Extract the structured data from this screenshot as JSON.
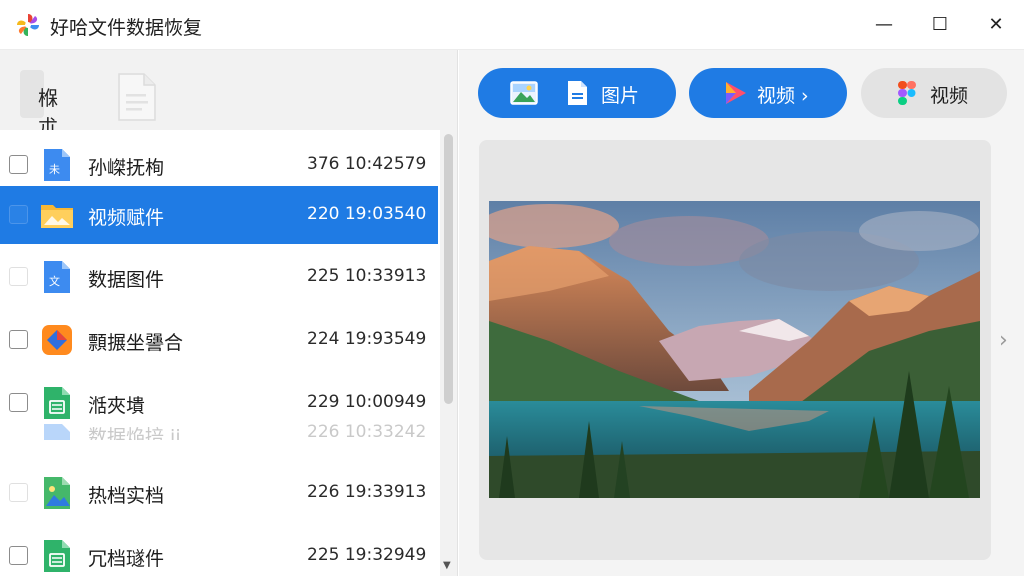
{
  "window": {
    "title": "好哈文件数据恢复",
    "minimize_glyph": "—",
    "maximize_glyph": "☐",
    "close_glyph": "✕"
  },
  "sidebar_header": {
    "tab_label": "椺 朮",
    "doc_icon": "document-icon"
  },
  "files": [
    {
      "name": "孙嵥抚栒",
      "meta": "376 10:42579",
      "icon": "document-blue-icon",
      "state": "normal"
    },
    {
      "name": "视频赋件",
      "meta": "220 19:03540",
      "icon": "folder-icon",
      "state": "selected"
    },
    {
      "name": "数据图件",
      "meta": "225 10:33913",
      "icon": "document-blue-icon",
      "state": "faded"
    },
    {
      "name": "顠搌坐謽合",
      "meta": "224 19:93549",
      "icon": "app-orange-icon",
      "state": "normal"
    },
    {
      "name": "湉夾墤",
      "meta": "229 10:00949",
      "icon": "document-green-icon",
      "state": "normal"
    },
    {
      "name": "数据焔掊 ij",
      "meta": "226 10:33242",
      "icon": "document-blue-icon",
      "state": "ghost"
    },
    {
      "name": "热档实档",
      "meta": "226 19:33913",
      "icon": "image-file-icon",
      "state": "faded"
    },
    {
      "name": "冗档璲件",
      "meta": "225 19:32949",
      "icon": "document-green-icon",
      "state": "normal"
    }
  ],
  "toolbar": {
    "images_label": "图片",
    "video_label": "视频 ›",
    "video2_label": "视频"
  },
  "preview": {
    "next_glyph": "›",
    "image": "mountain-lake-landscape"
  },
  "colors": {
    "accent": "#1f7be4",
    "selected_row": "#1f7be4",
    "panel_bg": "#f2f2f2"
  }
}
